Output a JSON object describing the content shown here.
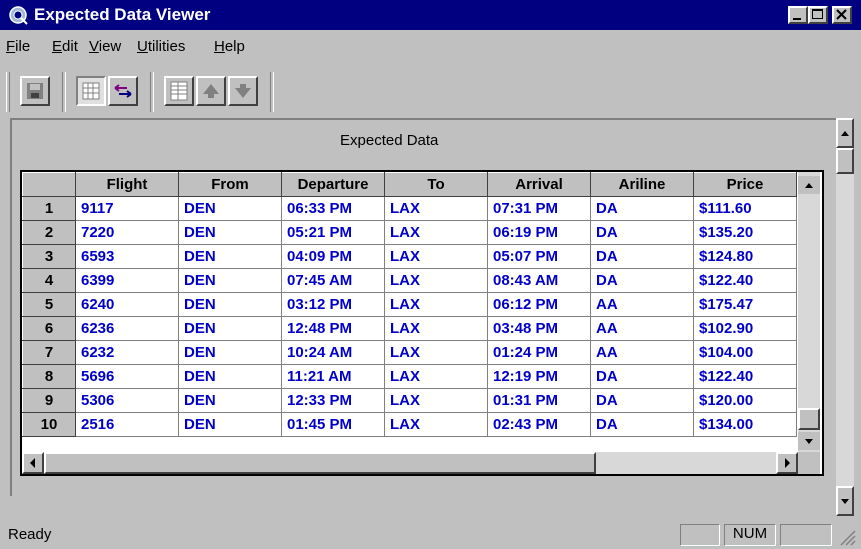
{
  "window": {
    "title": "Expected Data Viewer",
    "accent": "#000080"
  },
  "menu": [
    {
      "label": "File",
      "mnemonic": "F",
      "rest": "ile"
    },
    {
      "label": "Edit",
      "mnemonic": "E",
      "rest": "dit"
    },
    {
      "label": "View",
      "mnemonic": "V",
      "rest": "iew"
    },
    {
      "label": "Utilities",
      "mnemonic": "U",
      "rest": "tilities"
    },
    {
      "label": "Help",
      "mnemonic": "H",
      "rest": "elp"
    }
  ],
  "toolbar": {
    "icons": [
      "save-icon",
      "grid-view-icon",
      "swap-arrows-icon",
      "table-icon",
      "arrow-up-icon",
      "arrow-down-icon"
    ]
  },
  "caption": "Expected Data",
  "table": {
    "columns": [
      "Flight",
      "From",
      "Departure",
      "To",
      "Arrival",
      "Ariline",
      "Price"
    ],
    "rows": [
      {
        "n": "1",
        "cells": [
          "9117",
          "DEN",
          "06:33 PM",
          "LAX",
          "07:31 PM",
          "DA",
          "$111.60"
        ]
      },
      {
        "n": "2",
        "cells": [
          "7220",
          "DEN",
          "05:21 PM",
          "LAX",
          "06:19 PM",
          "DA",
          "$135.20"
        ]
      },
      {
        "n": "3",
        "cells": [
          "6593",
          "DEN",
          "04:09 PM",
          "LAX",
          "05:07 PM",
          "DA",
          "$124.80"
        ]
      },
      {
        "n": "4",
        "cells": [
          "6399",
          "DEN",
          "07:45 AM",
          "LAX",
          "08:43 AM",
          "DA",
          "$122.40"
        ]
      },
      {
        "n": "5",
        "cells": [
          "6240",
          "DEN",
          "03:12 PM",
          "LAX",
          "06:12 PM",
          "AA",
          "$175.47"
        ]
      },
      {
        "n": "6",
        "cells": [
          "6236",
          "DEN",
          "12:48 PM",
          "LAX",
          "03:48 PM",
          "AA",
          "$102.90"
        ]
      },
      {
        "n": "7",
        "cells": [
          "6232",
          "DEN",
          "10:24 AM",
          "LAX",
          "01:24 PM",
          "AA",
          "$104.00"
        ]
      },
      {
        "n": "8",
        "cells": [
          "5696",
          "DEN",
          "11:21 AM",
          "LAX",
          "12:19 PM",
          "DA",
          "$122.40"
        ]
      },
      {
        "n": "9",
        "cells": [
          "5306",
          "DEN",
          "12:33 PM",
          "LAX",
          "01:31 PM",
          "DA",
          "$120.00"
        ]
      },
      {
        "n": "10",
        "cells": [
          "2516",
          "DEN",
          "01:45 PM",
          "LAX",
          "02:43 PM",
          "DA",
          "$134.00"
        ]
      }
    ],
    "cell_color": "#0000c8"
  },
  "status": {
    "text": "Ready",
    "num": "NUM"
  }
}
